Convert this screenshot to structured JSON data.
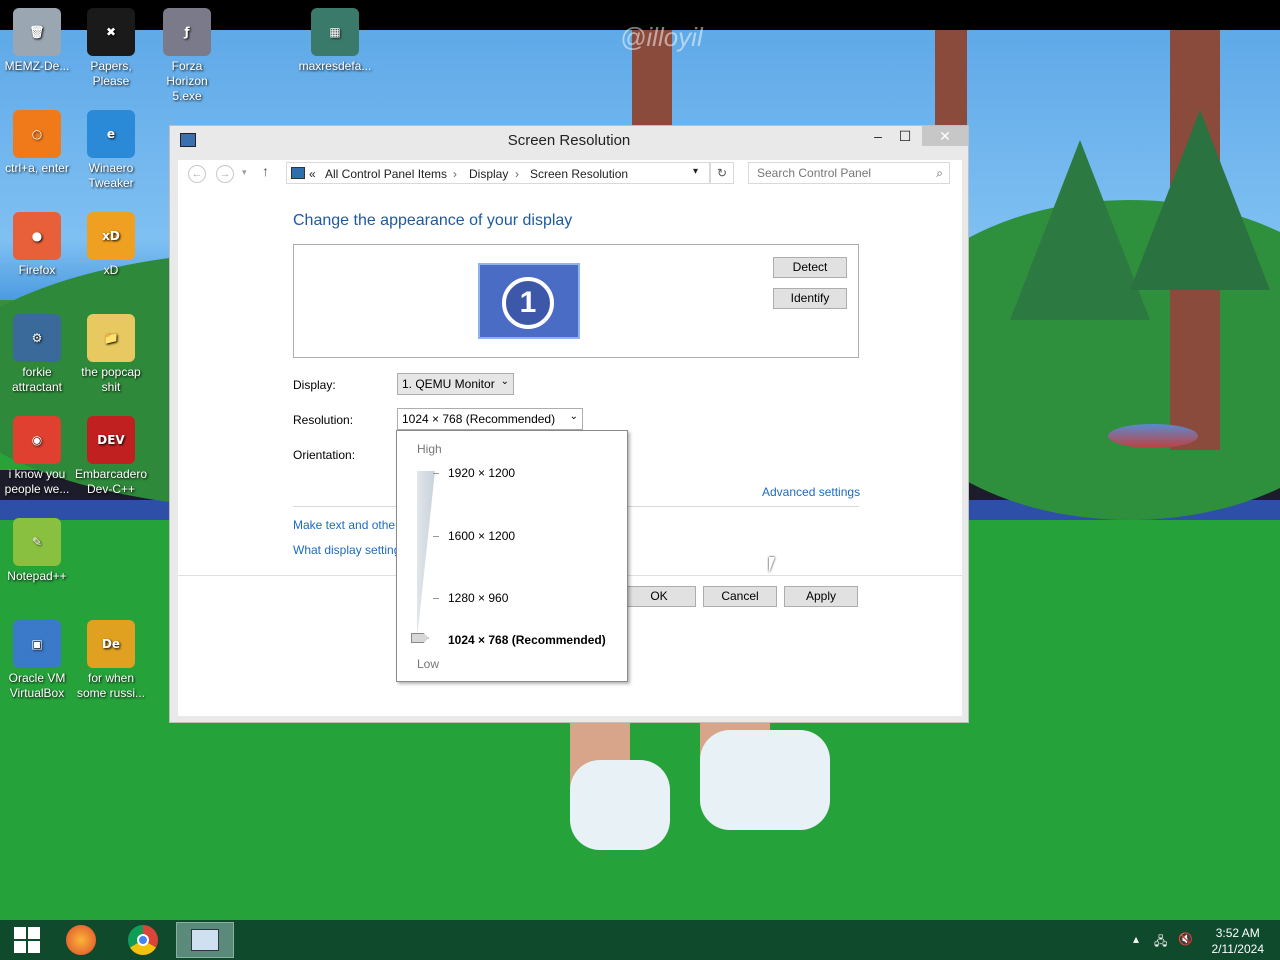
{
  "desktop": {
    "watermark": "@illoyil",
    "icons": [
      {
        "label": "MEMZ-De...",
        "color": "#9aa6b2",
        "glyph": "🗑"
      },
      {
        "label": "Papers, Please",
        "color": "#1a1a1a",
        "glyph": "✖"
      },
      {
        "label": "Forza Horizon 5.exe",
        "color": "#7a7a8a",
        "glyph": "ƒ"
      },
      {
        "label": "maxresdefa...",
        "color": "#3a7a6a",
        "glyph": "▦"
      },
      {
        "label": "ctrl+a, enter",
        "color": "#f07a1a",
        "glyph": "○"
      },
      {
        "label": "Winaero Tweaker",
        "color": "#2a8ad8",
        "glyph": "e"
      },
      {
        "label": "Firefox",
        "color": "#e8603a",
        "glyph": "●"
      },
      {
        "label": "xD",
        "color": "#f0a020",
        "glyph": "xD"
      },
      {
        "label": "forkie attractant",
        "color": "#3a6a9a",
        "glyph": "⚙"
      },
      {
        "label": "the popcap shit",
        "color": "#e8c860",
        "glyph": "📁"
      },
      {
        "label": "i know you people we...",
        "color": "#e04030",
        "glyph": "◉"
      },
      {
        "label": "Embarcadero Dev-C++",
        "color": "#c02020",
        "glyph": "DEV"
      },
      {
        "label": "Notepad++",
        "color": "#8ac040",
        "glyph": "✎"
      },
      {
        "label": "Oracle VM VirtualBox",
        "color": "#3a7ac8",
        "glyph": "▣"
      },
      {
        "label": "for when some russi...",
        "color": "#e0a020",
        "glyph": "De"
      }
    ]
  },
  "window": {
    "title": "Screen Resolution",
    "minimize": "‒",
    "maximize": "☐",
    "close": "✕",
    "address": {
      "root": "«",
      "crumbs": [
        "All Control Panel Items",
        "Display",
        "Screen Resolution"
      ],
      "separator": "›"
    },
    "search_placeholder": "Search Control Panel",
    "heading": "Change the appearance of your display",
    "monitor_number": "1",
    "detect": "Detect",
    "identify": "Identify",
    "display_label": "Display:",
    "display_value": "1. QEMU Monitor",
    "resolution_label": "Resolution:",
    "resolution_value": "1024 × 768 (Recommended)",
    "orientation_label": "Orientation:",
    "advanced_link": "Advanced settings",
    "link1": "Make text and other",
    "link2": "What display setting",
    "ok": "OK",
    "cancel": "Cancel",
    "apply": "Apply"
  },
  "popup": {
    "high": "High",
    "low": "Low",
    "options": [
      "1920 × 1200",
      "1600 × 1200",
      "1280 × 960",
      "1024 × 768 (Recommended)"
    ],
    "selected_index": 3
  },
  "taskbar": {
    "time": "3:52 AM",
    "date": "2/11/2024"
  }
}
